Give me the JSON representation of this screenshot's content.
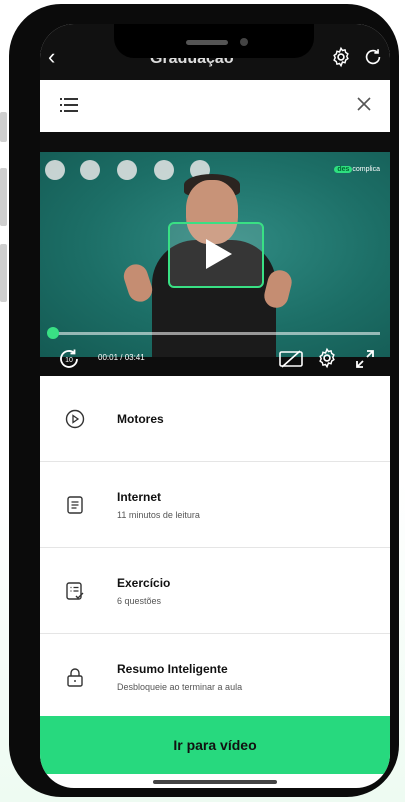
{
  "app": {
    "top_title": "Graduação"
  },
  "video": {
    "brand_prefix": "des",
    "brand_suffix": "complica",
    "time": "00:01 / 03:41",
    "progress": 0.02
  },
  "lesson_items": [
    {
      "title": "Motores",
      "subtitle": "",
      "icon": "play-circle-icon"
    },
    {
      "title": "Internet",
      "subtitle": "11 minutos de leitura",
      "icon": "document-icon"
    },
    {
      "title": "Exercício",
      "subtitle": "6 questões",
      "icon": "checklist-icon"
    },
    {
      "title": "Resumo Inteligente",
      "subtitle": "Desbloqueie ao terminar a aula",
      "icon": "lock-icon"
    }
  ],
  "cta": {
    "label": "Ir para vídeo"
  },
  "colors": {
    "accent": "#27d97e",
    "video_bg": "#1c6e66"
  }
}
